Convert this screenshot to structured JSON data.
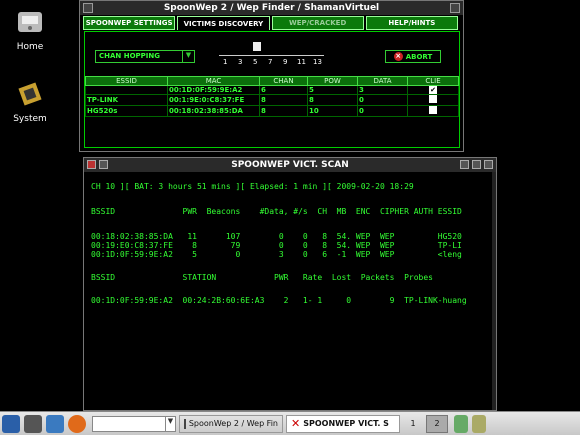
{
  "desktop": {
    "icons": [
      {
        "label": "Home"
      },
      {
        "label": "System"
      }
    ]
  },
  "finder": {
    "title": "SpoonWep 2 / Wep Finder / ShamanVirtuel",
    "tabs": [
      "SPOONWEP SETTINGS",
      "VICTIMS DISCOVERY",
      "WEP/CRACKED",
      "HELP/HINTS"
    ],
    "mode": "CHAN HOPPING",
    "slider_labels": [
      "1",
      "3",
      "5",
      "7",
      "9",
      "11",
      "13"
    ],
    "abort_label": "ABORT",
    "columns": [
      "ESSID",
      "MAC",
      "CHAN",
      "POW",
      "DATA",
      "CLIE"
    ],
    "rows": [
      [
        "",
        "00:1D:0F:59:9E:A2",
        "6",
        "5",
        "3",
        "✔"
      ],
      [
        "TP-LINK",
        "00:1:9E:0:C8:37:FE",
        "8",
        "8",
        "0",
        ""
      ],
      [
        "HG520s",
        "00:18:02:38:85:DA",
        "8",
        "10",
        "0",
        ""
      ]
    ]
  },
  "scan": {
    "title": "SPOONWEP VICT. SCAN",
    "lines": [
      "CH 10 ][ BAT: 3 hours 51 mins ][ Elapsed: 1 min ][ 2009-02-20 18:29",
      "",
      "BSSID              PWR  Beacons    #Data, #/s  CH  MB  ENC  CIPHER AUTH ESSID",
      "",
      "00:18:02:38:85:DA   11      107        0    0   8  54. WEP  WEP         HG520",
      "00:19:E0:C8:37:FE    8       79        0    0   8  54. WEP  WEP         TP-LI",
      "00:1D:0F:59:9E:A2    5        0        3    0   6  -1  WEP  WEP         <leng",
      "",
      "BSSID              STATION            PWR   Rate  Lost  Packets  Probes",
      "",
      "00:1D:0F:59:9E:A2  00:24:2B:60:6E:A3    2   1- 1     0        9  TP-LINK-huang"
    ]
  },
  "taskbar": {
    "task1": "SpoonWep 2 / Wep Fin",
    "task2": "SPOONWEP VICT. S",
    "desk1": "1",
    "desk2": "2"
  }
}
